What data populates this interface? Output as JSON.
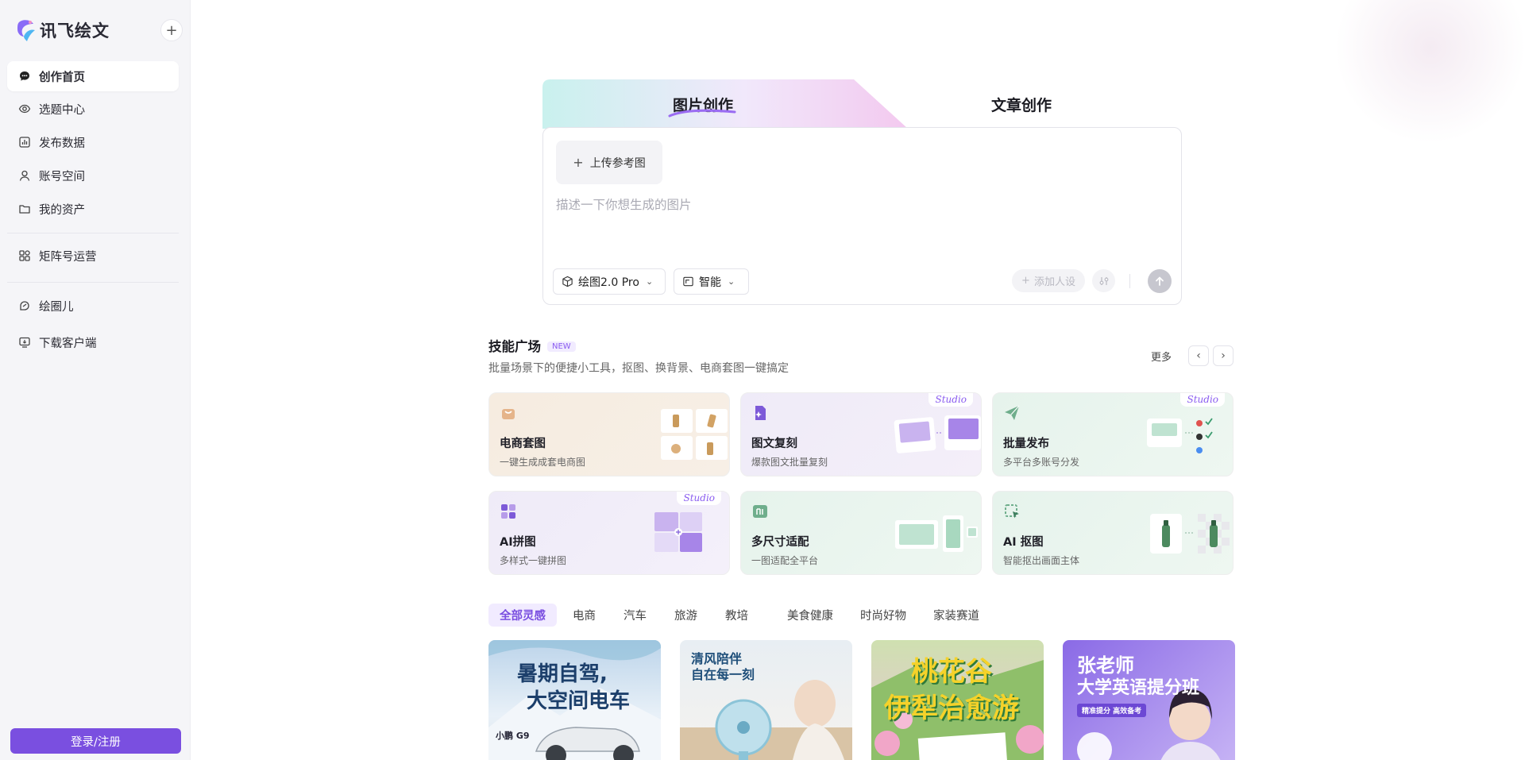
{
  "app": {
    "name": "讯飞绘文",
    "brand_color": "#7a4fe0"
  },
  "sidebar": {
    "items": [
      {
        "label": "创作首页",
        "icon": "chat-bubble-icon",
        "active": true
      },
      {
        "label": "选题中心",
        "icon": "eye-icon"
      },
      {
        "label": "发布数据",
        "icon": "bar-chart-icon"
      },
      {
        "label": "账号空间",
        "icon": "user-icon"
      },
      {
        "label": "我的资产",
        "icon": "folder-icon"
      },
      {
        "label": "矩阵号运营",
        "icon": "grid-apps-icon"
      },
      {
        "label": "绘圈儿",
        "icon": "community-icon"
      },
      {
        "label": "下载客户端",
        "icon": "download-icon"
      }
    ],
    "login_label": "登录/注册"
  },
  "compose": {
    "tabs": [
      {
        "label": "图片创作",
        "active": true
      },
      {
        "label": "文章创作"
      }
    ],
    "upload_label": "上传参考图",
    "prompt_placeholder": "描述一下你想生成的图片",
    "model_label": "绘图2.0 Pro",
    "ratio_label": "智能",
    "add_preset_label": "添加人设"
  },
  "skills": {
    "title": "技能广场",
    "badge": "NEW",
    "subtitle": "批量场景下的便捷小工具，抠图、换背景、电商套图一键搞定",
    "more_label": "更多",
    "studio_label": "Studio",
    "cards": [
      {
        "title": "电商套图",
        "sub": "一键生成成套电商图"
      },
      {
        "title": "图文复刻",
        "sub": "爆款图文批量复刻",
        "studio": true
      },
      {
        "title": "批量发布",
        "sub": "多平台多账号分发",
        "studio": true
      },
      {
        "title": "AI拼图",
        "sub": "多样式一键拼图",
        "studio": true
      },
      {
        "title": "多尺寸适配",
        "sub": "一图适配全平台"
      },
      {
        "title": "AI 抠图",
        "sub": "智能抠出画面主体"
      }
    ]
  },
  "categories": [
    "全部灵感",
    "电商",
    "汽车",
    "旅游",
    "教培",
    "美食健康",
    "时尚好物",
    "家装赛道"
  ],
  "gallery": [
    {
      "line1": "暑期自驾,",
      "line2": "大空间电车",
      "tag": "小鹏 G9"
    },
    {
      "line1": "清风陪伴",
      "line2": "自在每一刻"
    },
    {
      "line1": "桃花谷",
      "line2": "伊犁治愈游"
    },
    {
      "line1": "张老师",
      "line2": "大学英语提分班",
      "tag": "精准提分 高效备考"
    }
  ]
}
